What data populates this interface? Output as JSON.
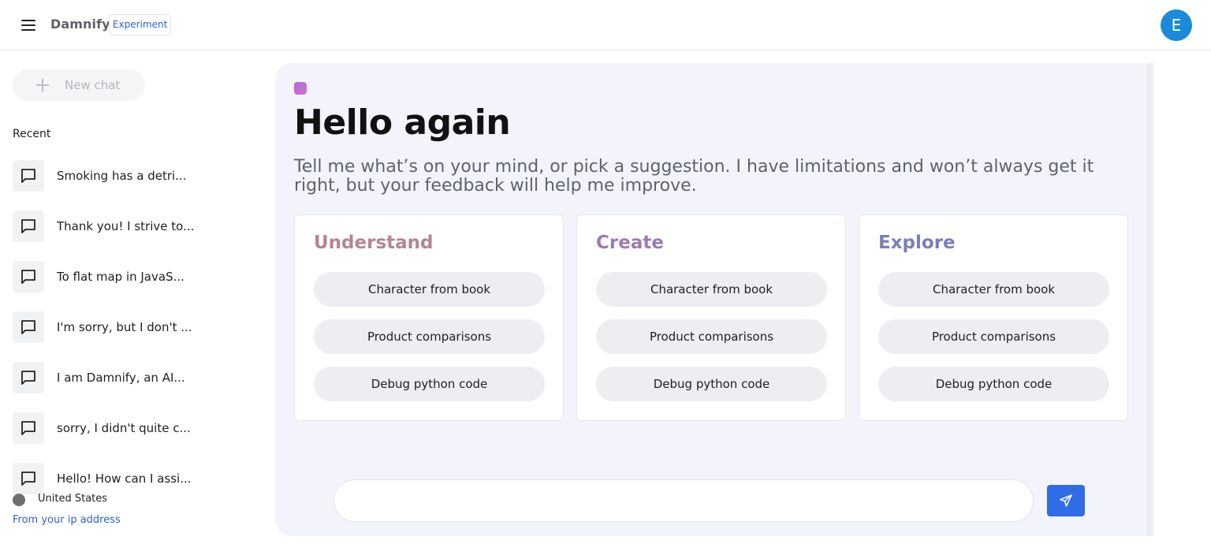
{
  "header": {
    "brand": "Damnify",
    "badge": "Experiment",
    "avatar_initial": "E",
    "avatar_color": "#1b8ad8"
  },
  "sidebar": {
    "new_chat_label": "New chat",
    "recent_label": "Recent",
    "chats": [
      "Smoking has a detri...",
      "Thank you! I strive to...",
      "To flat map in JavaS...",
      "I'm sorry, but I don't ...",
      "I am Damnify, an AI...",
      "sorry, I didn't quite c...",
      "Hello! How can I assi..."
    ],
    "location": "United States",
    "ip_link": "From your ip address"
  },
  "main": {
    "title": "Hello again",
    "subtitle": "Tell me what’s on your mind, or pick a suggestion. I have limitations and won’t always get it right, but your feedback will help me improve.",
    "cards": [
      {
        "heading": "Understand",
        "color": "#b48592",
        "suggestions": [
          "Character from book",
          "Product comparisons",
          "Debug python code"
        ]
      },
      {
        "heading": "Create",
        "color": "#9c7bb0",
        "suggestions": [
          "Character from book",
          "Product comparisons",
          "Debug python code"
        ]
      },
      {
        "heading": "Explore",
        "color": "#7b7fb6",
        "suggestions": [
          "Character from book",
          "Product comparisons",
          "Debug python code"
        ]
      }
    ],
    "input_placeholder": "",
    "send_color": "#2f6ce6"
  },
  "icons": {
    "menu": "menu-icon",
    "new_chat": "plus-icon",
    "chat": "chat-bubble-icon",
    "location": "location-dot-icon",
    "send": "send-icon"
  }
}
